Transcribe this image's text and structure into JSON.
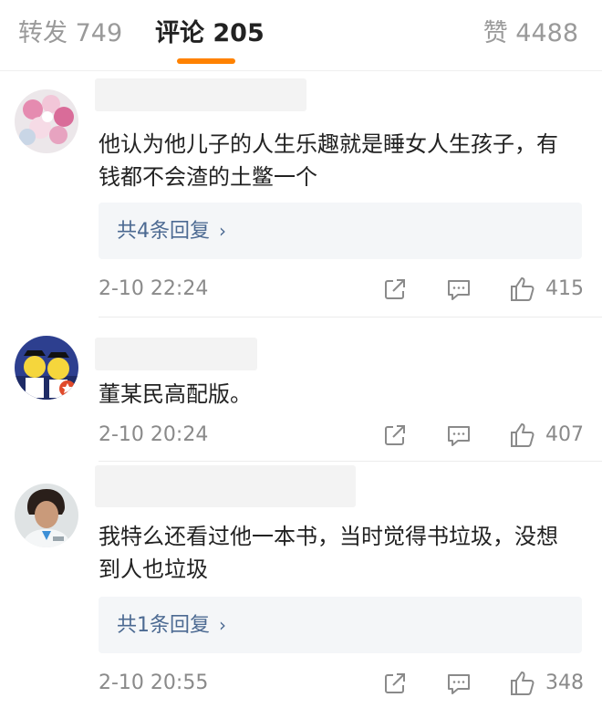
{
  "tabs": {
    "repost": "转发 749",
    "comment": "评论 205",
    "like": "赞 4488",
    "accent": "#ff8200"
  },
  "comments": [
    {
      "text": "他认为他儿子的人生乐趣就是睡女人生孩子，有钱都不会渣的土鳖一个",
      "replies": "共4条回复",
      "time": "2-10 22:24",
      "likes": "415"
    },
    {
      "text": "董某民高配版。",
      "time": "2-10 20:24",
      "likes": "407"
    },
    {
      "text": "我特么还看过他一本书，当时觉得书垃圾，没想到人也垃圾",
      "replies": "共1条回复",
      "time": "2-10 20:55",
      "likes": "348"
    }
  ],
  "icons": [
    "share-icon",
    "reply-icon",
    "thumbs-up-icon",
    "chevron-right-icon"
  ]
}
